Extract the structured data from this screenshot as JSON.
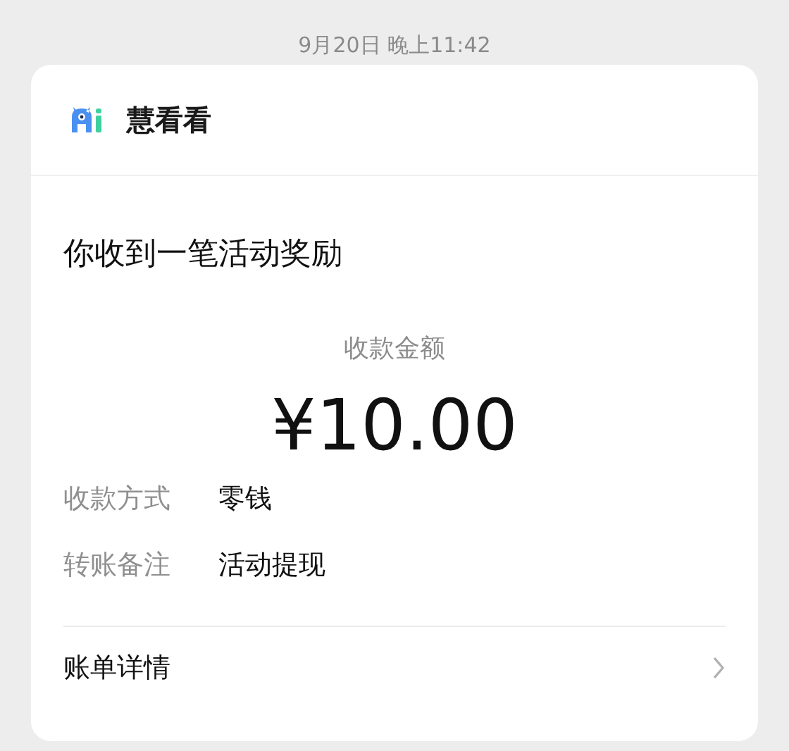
{
  "timestamp": "9月20日 晚上11:42",
  "card": {
    "app_name": "慧看看",
    "title": "你收到一笔活动奖励",
    "amount_label": "收款金额",
    "amount": "¥10.00",
    "details": [
      {
        "label": "收款方式",
        "value": "零钱"
      },
      {
        "label": "转账备注",
        "value": "活动提现"
      }
    ],
    "link": "账单详情"
  }
}
